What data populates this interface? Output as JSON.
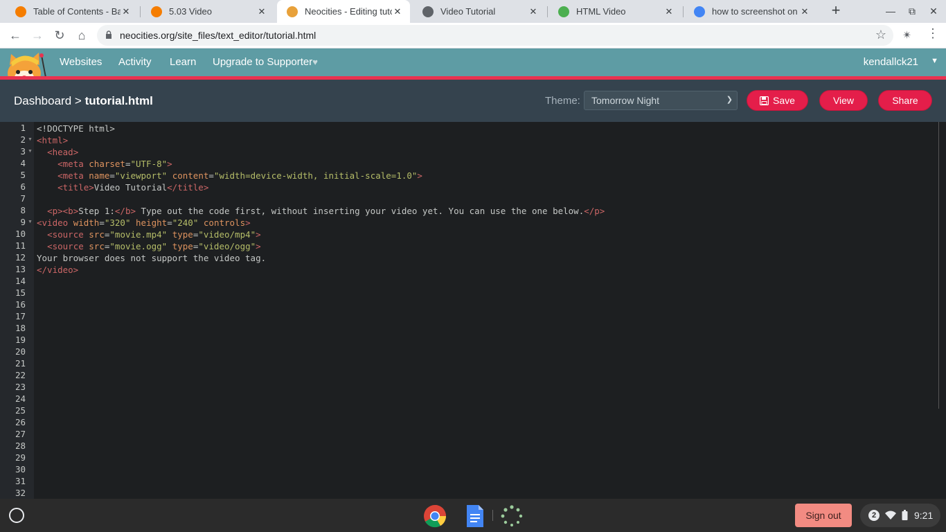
{
  "browser": {
    "tabs": [
      {
        "title": "Table of Contents - Basic",
        "icon": "blogger-icon",
        "color": "#f57d00"
      },
      {
        "title": "5.03 Video",
        "icon": "blogger-icon",
        "color": "#f57d00"
      },
      {
        "title": "Neocities - Editing tutorial",
        "icon": "neocities-cat-icon",
        "color": "#e8a13a",
        "active": true
      },
      {
        "title": "Video Tutorial",
        "icon": "globe-icon",
        "color": "#5f6368"
      },
      {
        "title": "HTML Video",
        "icon": "w3schools-icon",
        "color": "#4caf50"
      },
      {
        "title": "how to screenshot on ch",
        "icon": "google-icon",
        "color": "#4285f4"
      }
    ],
    "url": "neocities.org/site_files/text_editor/tutorial.html"
  },
  "site_nav": {
    "links": [
      "Websites",
      "Activity",
      "Learn",
      "Upgrade to Supporter"
    ],
    "heart": "♥",
    "user": "kendallck21"
  },
  "editbar": {
    "crumb_root": "Dashboard",
    "crumb_sep": ">",
    "crumb_file": "tutorial.html",
    "theme_label": "Theme:",
    "theme_value": "Tomorrow Night",
    "save_label": "Save",
    "view_label": "View",
    "share_label": "Share"
  },
  "editor": {
    "line_count": 32,
    "fold_lines": [
      2,
      3,
      9
    ],
    "lines": [
      [
        [
          "t",
          "<!DOCTYPE html>"
        ]
      ],
      [
        [
          "tag",
          "<html>"
        ]
      ],
      [
        [
          "t",
          "  "
        ],
        [
          "tag",
          "<head>"
        ]
      ],
      [
        [
          "t",
          "    "
        ],
        [
          "tag",
          "<meta "
        ],
        [
          "attr",
          "charset"
        ],
        [
          "t",
          "="
        ],
        [
          "str",
          "\"UTF-8\""
        ],
        [
          "tag",
          ">"
        ]
      ],
      [
        [
          "t",
          "    "
        ],
        [
          "tag",
          "<meta "
        ],
        [
          "attr",
          "name"
        ],
        [
          "t",
          "="
        ],
        [
          "str",
          "\"viewport\""
        ],
        [
          "t",
          " "
        ],
        [
          "attr",
          "content"
        ],
        [
          "t",
          "="
        ],
        [
          "str",
          "\"width=device-width, initial-scale=1.0\""
        ],
        [
          "tag",
          ">"
        ]
      ],
      [
        [
          "t",
          "    "
        ],
        [
          "tag",
          "<title>"
        ],
        [
          "t",
          "Video Tutorial"
        ],
        [
          "tag",
          "</title>"
        ]
      ],
      [
        [
          "t",
          ""
        ]
      ],
      [
        [
          "t",
          "  "
        ],
        [
          "tag",
          "<p><b>"
        ],
        [
          "t",
          "Step 1:"
        ],
        [
          "tag",
          "</b>"
        ],
        [
          "t",
          " Type out the code first, without inserting your video yet. You can use the one below."
        ],
        [
          "tag",
          "</p>"
        ]
      ],
      [
        [
          "tag",
          "<video "
        ],
        [
          "attr",
          "width"
        ],
        [
          "t",
          "="
        ],
        [
          "str",
          "\"320\""
        ],
        [
          "t",
          " "
        ],
        [
          "attr",
          "height"
        ],
        [
          "t",
          "="
        ],
        [
          "str",
          "\"240\""
        ],
        [
          "t",
          " "
        ],
        [
          "attr",
          "controls"
        ],
        [
          "tag",
          ">"
        ]
      ],
      [
        [
          "t",
          "  "
        ],
        [
          "tag",
          "<source "
        ],
        [
          "attr",
          "src"
        ],
        [
          "t",
          "="
        ],
        [
          "str",
          "\"movie.mp4\""
        ],
        [
          "t",
          " "
        ],
        [
          "attr",
          "type"
        ],
        [
          "t",
          "="
        ],
        [
          "str",
          "\"video/mp4\""
        ],
        [
          "tag",
          ">"
        ]
      ],
      [
        [
          "t",
          "  "
        ],
        [
          "tag",
          "<source "
        ],
        [
          "attr",
          "src"
        ],
        [
          "t",
          "="
        ],
        [
          "str",
          "\"movie.ogg\""
        ],
        [
          "t",
          " "
        ],
        [
          "attr",
          "type"
        ],
        [
          "t",
          "="
        ],
        [
          "str",
          "\"video/ogg\""
        ],
        [
          "tag",
          ">"
        ]
      ],
      [
        [
          "t",
          "Your browser does not support the video tag."
        ]
      ],
      [
        [
          "tag",
          "</video>"
        ]
      ]
    ]
  },
  "shelf": {
    "signout_label": "Sign out",
    "notif_count": "2",
    "time": "9:21"
  }
}
